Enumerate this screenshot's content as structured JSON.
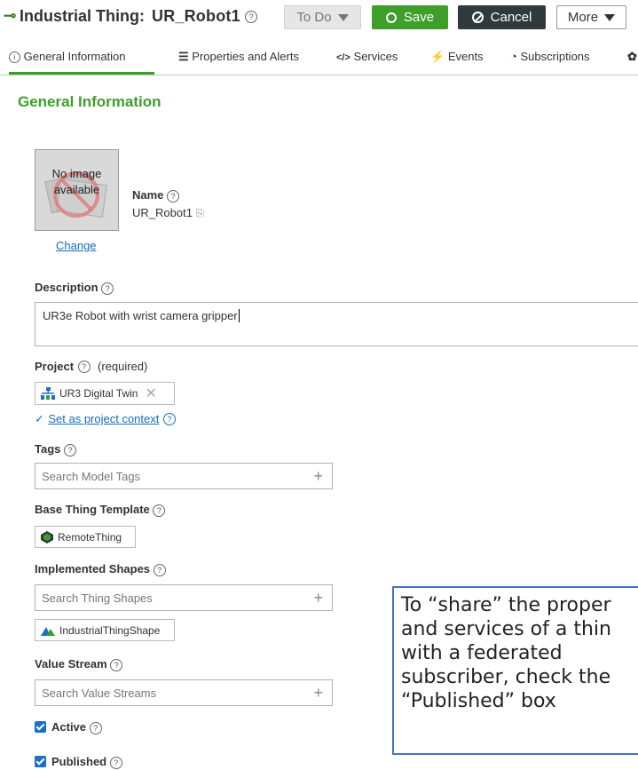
{
  "header": {
    "thing_icon": "link-chain-icon",
    "type_label": "Industrial Thing:",
    "thing_name": "UR_Robot1",
    "help_glyph": "?",
    "state_button": "To Do",
    "save_label": "Save",
    "cancel_label": "Cancel",
    "more_label": "More"
  },
  "tabs": [
    {
      "label": "General Information",
      "icon": "info-icon",
      "active": true
    },
    {
      "label": "Properties and Alerts",
      "icon": "list-icon"
    },
    {
      "label": "Services",
      "icon": "code-icon"
    },
    {
      "label": "Events",
      "icon": "lightning-icon"
    },
    {
      "label": "Subscriptions",
      "icon": "signal-icon"
    }
  ],
  "general": {
    "section_title": "General Information",
    "image_placeholder": "No image available",
    "change_link": "Change",
    "name_label": "Name",
    "name_value": "UR_Robot1",
    "description_label": "Description",
    "description_value": "UR3e Robot with wrist camera gripper",
    "project_label": "Project",
    "project_required": "(required)",
    "project_value": "UR3 Digital Twin",
    "set_context_link": "Set as project context",
    "tags_label": "Tags",
    "tags_placeholder": "Search Model Tags",
    "base_template_label": "Base Thing Template",
    "base_template_value": "RemoteThing",
    "shapes_label": "Implemented Shapes",
    "shapes_placeholder": "Search Thing Shapes",
    "shapes_value": "IndustrialThingShape",
    "value_stream_label": "Value Stream",
    "value_stream_placeholder": "Search Value Streams",
    "active_label": "Active",
    "active_checked": true,
    "published_label": "Published",
    "published_checked": true
  },
  "callout": {
    "text": "To “share” the proper\nand services of a thin\nwith a federated\nsubscriber, check the\n“Published” box"
  },
  "colors": {
    "accent_green": "#3f9e2a",
    "dark_button": "#2f3a3d",
    "link_blue": "#1a6ab8",
    "callout_border": "#4472c4"
  }
}
